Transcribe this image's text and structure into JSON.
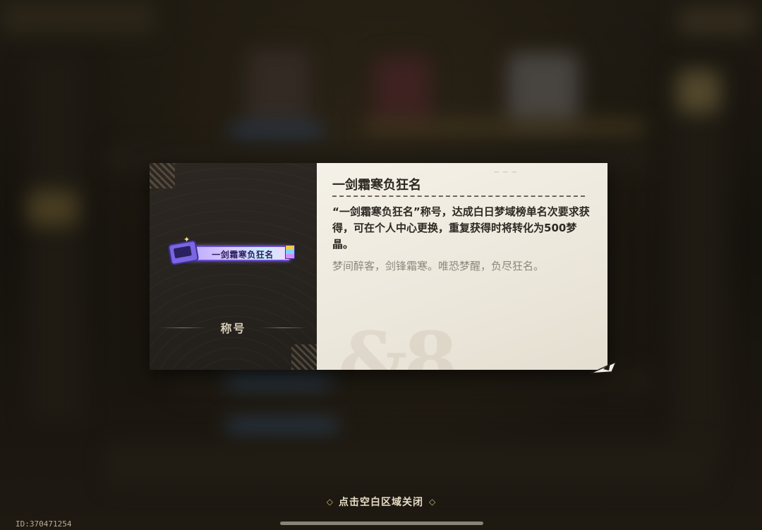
{
  "popup": {
    "category_label": "称号",
    "badge_text": "一剑霜寒负狂名",
    "item_name": "一剑霜寒负狂名",
    "description": "“一剑霜寒负狂名”称号，达成白日梦域榜单名次要求获得，可在个人中心更换，重复获得时将转化为500梦晶。",
    "flavor_text": "梦间醉客，剑锋霜寒。唯恐梦醒，负尽狂名。"
  },
  "footer": {
    "close_hint": "点击空白区域关闭",
    "player_id": "ID:370471254"
  },
  "colors": {
    "panel_dark": "#26221e",
    "panel_light": "#f1ede3",
    "accent_gold": "#cdb77f",
    "badge_purple": "#6b4fc8"
  }
}
